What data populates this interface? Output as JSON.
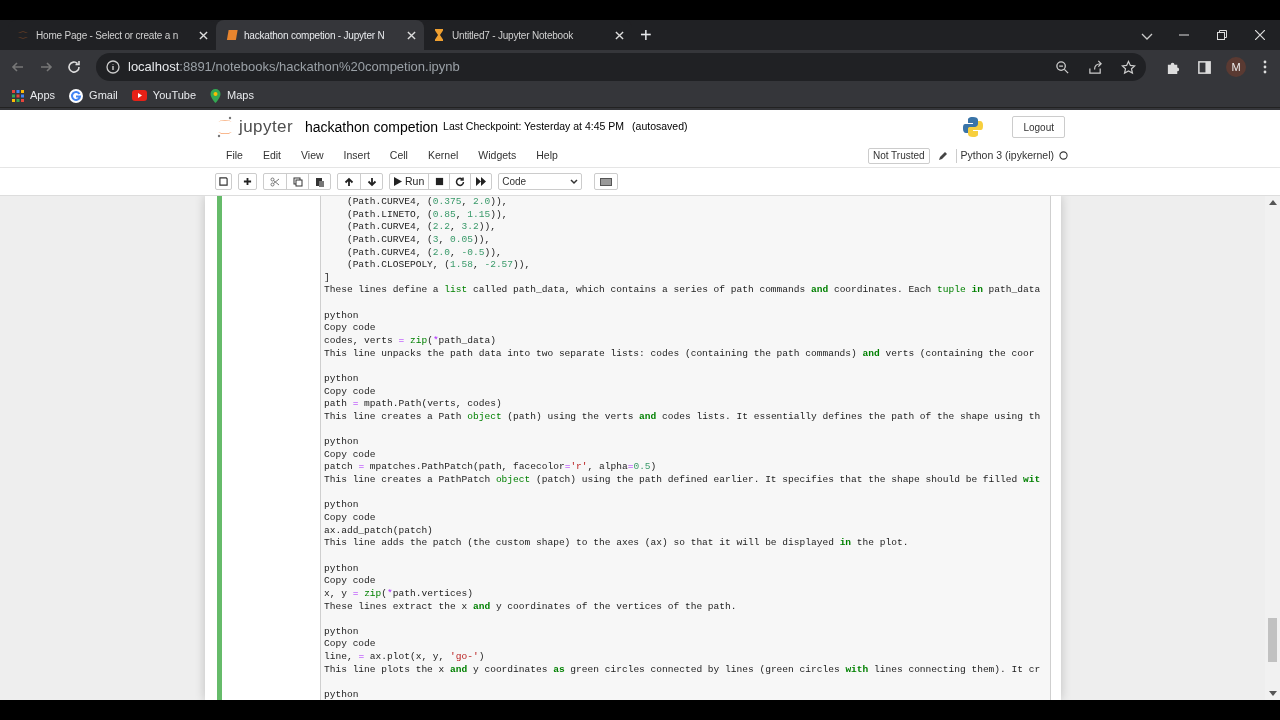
{
  "browser_tabs": [
    {
      "kind": "jupyter",
      "title": "Home Page - Select or create a n",
      "selected": false
    },
    {
      "kind": "notebook",
      "title": "hackathon competion - Jupyter N",
      "selected": true
    },
    {
      "kind": "hourglass",
      "title": "Untitled7 - Jupyter Notebook",
      "selected": false
    }
  ],
  "new_tab": "+",
  "address": {
    "host": "localhost",
    "rest": ":8891/notebooks/hackathon%20competion.ipynb"
  },
  "profile": "M",
  "bookmarks": [
    {
      "kind": "apps",
      "label": "Apps"
    },
    {
      "kind": "gmail",
      "label": "Gmail"
    },
    {
      "kind": "youtube",
      "label": "YouTube"
    },
    {
      "kind": "maps",
      "label": "Maps"
    }
  ],
  "jupyter": {
    "logo": "jupyter",
    "notebook_name": "hackathon competion",
    "checkpoint": "Last Checkpoint: Yesterday at 4:45 PM",
    "autosave": "(autosaved)",
    "logout": "Logout",
    "menu": [
      "File",
      "Edit",
      "View",
      "Insert",
      "Cell",
      "Kernel",
      "Widgets",
      "Help"
    ],
    "trust": "Not Trusted",
    "kernel": "Python 3 (ipykernel)",
    "run": "Run",
    "cell_type": "Code"
  },
  "cell": {
    "selected": true,
    "lines": [
      {
        "kind": "code",
        "tokens": [
          {
            "text": "    (Path.CURVE4, (",
            "kind": "plain"
          },
          {
            "text": "0.375",
            "kind": "num"
          },
          {
            "text": ", ",
            "kind": "plain"
          },
          {
            "text": "2.0",
            "kind": "num"
          },
          {
            "text": ")),",
            "kind": "plain"
          }
        ]
      },
      {
        "kind": "code",
        "tokens": [
          {
            "text": "    (Path.LINETO, (",
            "kind": "plain"
          },
          {
            "text": "0.85",
            "kind": "num"
          },
          {
            "text": ", ",
            "kind": "plain"
          },
          {
            "text": "1.15",
            "kind": "num"
          },
          {
            "text": ")),",
            "kind": "plain"
          }
        ]
      },
      {
        "kind": "code",
        "tokens": [
          {
            "text": "    (Path.CURVE4, (",
            "kind": "plain"
          },
          {
            "text": "2.2",
            "kind": "num"
          },
          {
            "text": ", ",
            "kind": "plain"
          },
          {
            "text": "3.2",
            "kind": "num"
          },
          {
            "text": ")),",
            "kind": "plain"
          }
        ]
      },
      {
        "kind": "code",
        "tokens": [
          {
            "text": "    (Path.CURVE4, (",
            "kind": "plain"
          },
          {
            "text": "3",
            "kind": "num"
          },
          {
            "text": ", ",
            "kind": "plain"
          },
          {
            "text": "0.05",
            "kind": "num"
          },
          {
            "text": ")),",
            "kind": "plain"
          }
        ]
      },
      {
        "kind": "code",
        "tokens": [
          {
            "text": "    (Path.CURVE4, (",
            "kind": "plain"
          },
          {
            "text": "2.0",
            "kind": "num"
          },
          {
            "text": ", ",
            "kind": "plain"
          },
          {
            "text": "-0.5",
            "kind": "num"
          },
          {
            "text": ")),",
            "kind": "plain"
          }
        ]
      },
      {
        "kind": "code",
        "tokens": [
          {
            "text": "    (Path.CLOSEPOLY, (",
            "kind": "plain"
          },
          {
            "text": "1.58",
            "kind": "num"
          },
          {
            "text": ", ",
            "kind": "plain"
          },
          {
            "text": "-2.57",
            "kind": "num"
          },
          {
            "text": ")),",
            "kind": "plain"
          }
        ]
      },
      {
        "kind": "code",
        "tokens": [
          {
            "text": "]",
            "kind": "plain"
          }
        ]
      },
      {
        "kind": "code",
        "tokens": [
          {
            "text": "These lines define a ",
            "kind": "plain"
          },
          {
            "text": "list",
            "kind": "builtin"
          },
          {
            "text": " called path_data, which contains a series of path commands ",
            "kind": "plain"
          },
          {
            "text": "and",
            "kind": "kw"
          },
          {
            "text": " coordinates. Each ",
            "kind": "plain"
          },
          {
            "text": "tuple ",
            "kind": "builtin"
          },
          {
            "text": "in",
            "kind": "kw"
          },
          {
            "text": " path_data",
            "kind": "plain"
          }
        ]
      },
      {
        "kind": "blank"
      },
      {
        "kind": "code",
        "tokens": [
          {
            "text": "python",
            "kind": "plain"
          }
        ]
      },
      {
        "kind": "code",
        "tokens": [
          {
            "text": "Copy code",
            "kind": "plain"
          }
        ]
      },
      {
        "kind": "code",
        "tokens": [
          {
            "text": "codes, verts ",
            "kind": "plain"
          },
          {
            "text": "= ",
            "kind": "op"
          },
          {
            "text": "zip",
            "kind": "builtin"
          },
          {
            "text": "(",
            "kind": "plain"
          },
          {
            "text": "*",
            "kind": "op"
          },
          {
            "text": "path_data)",
            "kind": "plain"
          }
        ]
      },
      {
        "kind": "code",
        "tokens": [
          {
            "text": "This line unpacks the path data into two separate lists: codes (containing the path commands) ",
            "kind": "plain"
          },
          {
            "text": "and",
            "kind": "kw"
          },
          {
            "text": " verts (containing the coor",
            "kind": "plain"
          }
        ]
      },
      {
        "kind": "blank"
      },
      {
        "kind": "code",
        "tokens": [
          {
            "text": "python",
            "kind": "plain"
          }
        ]
      },
      {
        "kind": "code",
        "tokens": [
          {
            "text": "Copy code",
            "kind": "plain"
          }
        ]
      },
      {
        "kind": "code",
        "tokens": [
          {
            "text": "path ",
            "kind": "plain"
          },
          {
            "text": "=",
            "kind": "op"
          },
          {
            "text": " mpath.Path(verts, codes)",
            "kind": "plain"
          }
        ]
      },
      {
        "kind": "code",
        "tokens": [
          {
            "text": "This line creates a Path ",
            "kind": "plain"
          },
          {
            "text": "object",
            "kind": "builtin"
          },
          {
            "text": " (path) using the verts ",
            "kind": "plain"
          },
          {
            "text": "and",
            "kind": "kw"
          },
          {
            "text": " codes lists. It essentially defines the path of the shape using th",
            "kind": "plain"
          }
        ]
      },
      {
        "kind": "blank"
      },
      {
        "kind": "code",
        "tokens": [
          {
            "text": "python",
            "kind": "plain"
          }
        ]
      },
      {
        "kind": "code",
        "tokens": [
          {
            "text": "Copy code",
            "kind": "plain"
          }
        ]
      },
      {
        "kind": "code",
        "tokens": [
          {
            "text": "patch ",
            "kind": "plain"
          },
          {
            "text": "=",
            "kind": "op"
          },
          {
            "text": " mpatches.PathPatch(path, facecolor",
            "kind": "plain"
          },
          {
            "text": "=",
            "kind": "op"
          },
          {
            "text": "'r'",
            "kind": "str"
          },
          {
            "text": ", alpha",
            "kind": "plain"
          },
          {
            "text": "=",
            "kind": "op"
          },
          {
            "text": "0.5",
            "kind": "num"
          },
          {
            "text": ")",
            "kind": "plain"
          }
        ]
      },
      {
        "kind": "code",
        "tokens": [
          {
            "text": "This line creates a PathPatch ",
            "kind": "plain"
          },
          {
            "text": "object",
            "kind": "builtin"
          },
          {
            "text": " (patch) using the path defined earlier. It specifies that the shape should be filled ",
            "kind": "plain"
          },
          {
            "text": "wit",
            "kind": "kw"
          }
        ]
      },
      {
        "kind": "blank"
      },
      {
        "kind": "code",
        "tokens": [
          {
            "text": "python",
            "kind": "plain"
          }
        ]
      },
      {
        "kind": "code",
        "tokens": [
          {
            "text": "Copy code",
            "kind": "plain"
          }
        ]
      },
      {
        "kind": "code",
        "tokens": [
          {
            "text": "ax.add_patch(patch)",
            "kind": "plain"
          }
        ]
      },
      {
        "kind": "code",
        "tokens": [
          {
            "text": "This line adds the patch (the custom shape) to the axes (ax) so that it will be displayed ",
            "kind": "plain"
          },
          {
            "text": "in",
            "kind": "kw"
          },
          {
            "text": " the plot.",
            "kind": "plain"
          }
        ]
      },
      {
        "kind": "blank"
      },
      {
        "kind": "code",
        "tokens": [
          {
            "text": "python",
            "kind": "plain"
          }
        ]
      },
      {
        "kind": "code",
        "tokens": [
          {
            "text": "Copy code",
            "kind": "plain"
          }
        ]
      },
      {
        "kind": "code",
        "tokens": [
          {
            "text": "x, y ",
            "kind": "plain"
          },
          {
            "text": "= ",
            "kind": "op"
          },
          {
            "text": "zip",
            "kind": "builtin"
          },
          {
            "text": "(",
            "kind": "plain"
          },
          {
            "text": "*",
            "kind": "op"
          },
          {
            "text": "path.vertices)",
            "kind": "plain"
          }
        ]
      },
      {
        "kind": "code",
        "tokens": [
          {
            "text": "These lines extract the x ",
            "kind": "plain"
          },
          {
            "text": "and",
            "kind": "kw"
          },
          {
            "text": " y coordinates of the vertices of the path.",
            "kind": "plain"
          }
        ]
      },
      {
        "kind": "blank"
      },
      {
        "kind": "code",
        "tokens": [
          {
            "text": "python",
            "kind": "plain"
          }
        ]
      },
      {
        "kind": "code",
        "tokens": [
          {
            "text": "Copy code",
            "kind": "plain"
          }
        ]
      },
      {
        "kind": "code",
        "tokens": [
          {
            "text": "line, ",
            "kind": "plain"
          },
          {
            "text": "=",
            "kind": "op"
          },
          {
            "text": " ax.plot(x, y, ",
            "kind": "plain"
          },
          {
            "text": "'go-'",
            "kind": "str"
          },
          {
            "text": ")",
            "kind": "plain"
          }
        ]
      },
      {
        "kind": "code",
        "tokens": [
          {
            "text": "This line plots the x ",
            "kind": "plain"
          },
          {
            "text": "and",
            "kind": "kw"
          },
          {
            "text": " y coordinates ",
            "kind": "plain"
          },
          {
            "text": "as",
            "kind": "kw"
          },
          {
            "text": " green circles connected by lines (green circles ",
            "kind": "plain"
          },
          {
            "text": "with",
            "kind": "kw"
          },
          {
            "text": " lines connecting them). It cr",
            "kind": "plain"
          }
        ]
      },
      {
        "kind": "blank"
      },
      {
        "kind": "code",
        "tokens": [
          {
            "text": "python",
            "kind": "plain"
          }
        ]
      }
    ]
  }
}
